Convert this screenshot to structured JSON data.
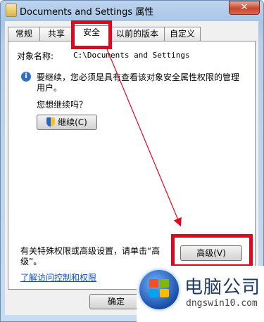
{
  "window": {
    "title": "Documents and Settings 属性",
    "close_glyph": "✕"
  },
  "tabs": [
    {
      "label": "常规"
    },
    {
      "label": "共享"
    },
    {
      "label": "安全",
      "active": true
    },
    {
      "label": "以前的版本"
    },
    {
      "label": "自定义"
    }
  ],
  "security": {
    "object_label": "对象名称:",
    "object_value": "C:\\Documents and Settings",
    "info_line1": "要继续，您必须是具有查看该对象安全属性权限的管理",
    "info_line2": "用户。",
    "continue_prompt": "您想继续吗？",
    "continue_button": "继续(C)",
    "special_line1": "有关特殊权限或高级设置，请单击“高",
    "special_line2": "级”。",
    "advanced_button": "高级(V)",
    "learn_link": "了解访问控制和权限"
  },
  "footer": {
    "ok_button": "确定"
  },
  "watermark": {
    "name": "电脑公司",
    "url": "dngswin10.com"
  },
  "colors": {
    "highlight_red": "#e1061d",
    "link_blue": "#0b4fc2"
  }
}
